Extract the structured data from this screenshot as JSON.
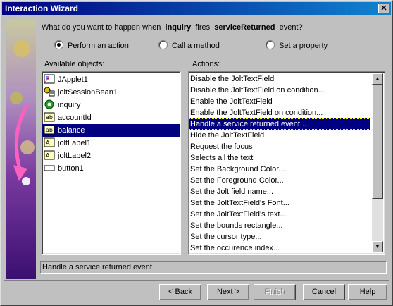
{
  "window": {
    "title": "Interaction Wizard"
  },
  "question": {
    "prefix": "What do you want to happen when",
    "object": "inquiry",
    "middle": "fires",
    "event": "serviceReturned",
    "suffix": "event?"
  },
  "options": [
    {
      "label": "Perform an action",
      "selected": true
    },
    {
      "label": "Call a method",
      "selected": false
    },
    {
      "label": "Set a property",
      "selected": false
    }
  ],
  "objects_label": "Available objects:",
  "objects": [
    {
      "label": "JApplet1",
      "icon": "applet-icon",
      "selected": false
    },
    {
      "label": "joltSessionBean1",
      "icon": "session-bean-icon",
      "selected": false
    },
    {
      "label": "inquiry",
      "icon": "service-bean-icon",
      "selected": false
    },
    {
      "label": "accountId",
      "icon": "textfield-icon",
      "selected": false
    },
    {
      "label": "balance",
      "icon": "textfield-icon",
      "selected": true
    },
    {
      "label": "joltLabel1",
      "icon": "label-icon",
      "selected": false
    },
    {
      "label": "joltLabel2",
      "icon": "label-icon",
      "selected": false
    },
    {
      "label": "button1",
      "icon": "button-icon",
      "selected": false
    }
  ],
  "actions_label": "Actions:",
  "actions": [
    "Disable the JoltTextField",
    "Disable the JoltTextField on condition...",
    "Enable the JoltTextField",
    "Enable the JoltTextField on condition...",
    "Handle a service returned event...",
    "Hide the JoltTextField",
    "Request the focus",
    "Selects all the text",
    "Set the Background Color...",
    "Set the Foreground Color...",
    "Set the Jolt field name...",
    "Set the JoltTextField's Font...",
    "Set the JoltTextField's text...",
    "Set the bounds rectangle...",
    "Set the cursor type...",
    "Set the occurence index..."
  ],
  "selected_action_index": 4,
  "status": "Handle a service returned event",
  "buttons": {
    "back": "< Back",
    "next": "Next >",
    "finish": "Finish",
    "cancel": "Cancel",
    "help": "Help"
  }
}
